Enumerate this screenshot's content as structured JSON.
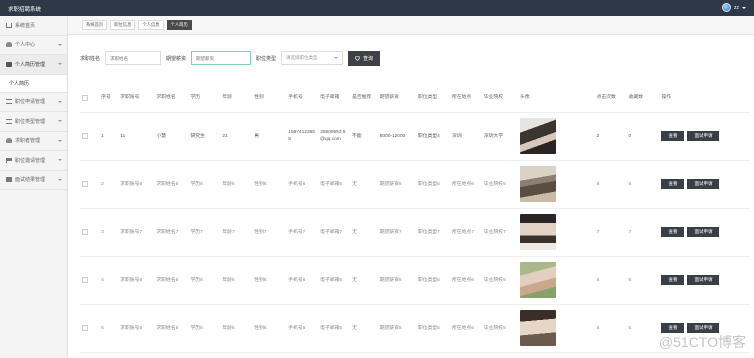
{
  "app": {
    "title": "求职招聘系统",
    "user": "zz"
  },
  "sidebar": {
    "items": [
      {
        "label": "系统首页",
        "icon": "home-icon"
      },
      {
        "label": "个人中心",
        "icon": "user-icon"
      },
      {
        "label": "个人简历管理",
        "icon": "monitor-icon",
        "open": true
      },
      {
        "label": "个人简历",
        "sub": true
      },
      {
        "label": "职位申请管理",
        "icon": "list-icon"
      },
      {
        "label": "职位类型管理",
        "icon": "list-icon"
      },
      {
        "label": "求职者管理",
        "icon": "user-icon"
      },
      {
        "label": "职位邀请管理",
        "icon": "flag-icon"
      },
      {
        "label": "面试结果管理",
        "icon": "box-icon"
      }
    ]
  },
  "tabs": [
    {
      "label": "系统首页"
    },
    {
      "label": "职位信息"
    },
    {
      "label": "个人信息"
    },
    {
      "label": "个人简历",
      "active": true
    }
  ],
  "search": {
    "name_label": "求职姓名",
    "name_placeholder": "求职姓名",
    "edu_label": "期望薪资",
    "edu_placeholder": "期望薪资",
    "type_label": "职位类型",
    "type_placeholder": "请选择职位类型",
    "button": "查询"
  },
  "table": {
    "headers": [
      "序号",
      "求职账号",
      "求职姓名",
      "学历",
      "年龄",
      "性别",
      "手机号",
      "电子邮箱",
      "是否推荐",
      "期望薪资",
      "职位类型",
      "所在地点",
      "毕业院校",
      "头像",
      "点击次数",
      "收藏数",
      "操作"
    ],
    "rows": [
      [
        "1",
        "11",
        "小慧",
        "研究生",
        "21",
        "男",
        "15874123698",
        "35609553 6@qq.com",
        "不能",
        "8000-12000",
        "职位类型4",
        "深圳",
        "深圳大学",
        "",
        "2",
        "0"
      ],
      [
        "2",
        "求职账号6",
        "求职姓名6",
        "学历6",
        "年龄6",
        "性别6",
        "手机号6",
        "电子邮箱6",
        "无",
        "期望薪资6",
        "职位类型6",
        "所在地点6",
        "毕业院校6",
        "",
        "8",
        "8"
      ],
      [
        "3",
        "求职账号7",
        "求职姓名7",
        "学历7",
        "年龄7",
        "性别7",
        "手机号7",
        "电子邮箱7",
        "无",
        "期望薪资7",
        "职位类型7",
        "所在地点7",
        "毕业院校7",
        "",
        "7",
        "7"
      ],
      [
        "4",
        "求职账号6",
        "求职姓名6",
        "学历6",
        "年龄6",
        "性别6",
        "手机号6",
        "电子邮箱6",
        "无",
        "期望薪资6",
        "职位类型6",
        "所在地点6",
        "毕业院校6",
        "",
        "6",
        "6"
      ],
      [
        "5",
        "求职账号5",
        "求职姓名5",
        "学历5",
        "年龄5",
        "性别5",
        "手机号5",
        "电子邮箱5",
        "无",
        "期望薪资5",
        "职位类型5",
        "所在地点5",
        "毕业院校5",
        "",
        "5",
        "5"
      ]
    ],
    "op_view": "查看",
    "op_interview": "面试申请"
  },
  "watermark": "@51CTO博客",
  "colors": {
    "topbar": "#2e3846",
    "button": "#3a3f45",
    "recommend": "#2aa45a",
    "focus": "#7ed3b2"
  }
}
